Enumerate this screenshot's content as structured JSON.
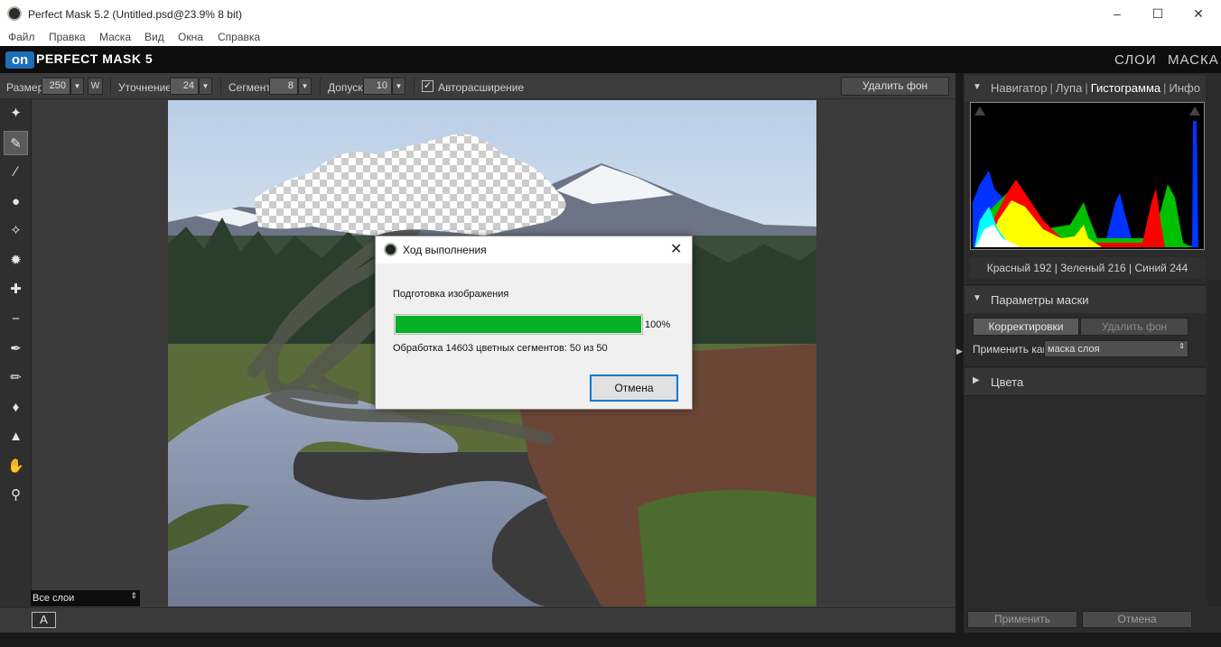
{
  "window": {
    "title": "Perfect Mask 5.2 (Untitled.psd@23.9% 8 bit)",
    "minimize_icon": "minimize-icon",
    "maximize_icon": "maximize-icon",
    "close_icon": "close-icon"
  },
  "menu": {
    "items": [
      "Файл",
      "Правка",
      "Маска",
      "Вид",
      "Окна",
      "Справка"
    ]
  },
  "header": {
    "logo_badge": "on",
    "logo_text": "PERFECT MASK 5",
    "tabs": [
      "СЛОИ",
      "МАСКА"
    ]
  },
  "options": {
    "size_label": "Размер",
    "size_value": "250",
    "w_label": "W",
    "refine_label": "Уточнение",
    "refine_value": "24",
    "segment_label": "Сегмент",
    "segment_value": "8",
    "tolerance_label": "Допуск",
    "tolerance_value": "10",
    "auto_expand_checked": true,
    "auto_expand_label": "Авторасширение",
    "remove_bg_label": "Удалить фон"
  },
  "tools": [
    "magic-brush-keep-icon",
    "magic-brush-drop-icon",
    "magic-brush-icon",
    "magic-brush-plus-icon",
    "magic-sparkle-icon",
    "splatter-icon",
    "eyedropper-plus-icon",
    "eyedropper-minus-icon",
    "pen-icon",
    "brush-icon",
    "drop-icon",
    "bucket-icon",
    "hand-icon",
    "zoom-icon"
  ],
  "layer_filter": {
    "value": "Все слои"
  },
  "bottom": {
    "a_label": "A"
  },
  "right_panel": {
    "nav_tabs": [
      "Навигатор",
      "Лупа",
      "Гистограмма",
      "Инфо"
    ],
    "active_tab": "Гистограмма",
    "histogram_readout": "Красный 192 | Зеленый 216 | Синий 244",
    "mask_params_title": "Параметры маски",
    "corrections_label": "Корректировки",
    "remove_bg_label": "Удалить фон",
    "apply_as_label": "Применить как",
    "apply_as_value": "маска слоя",
    "colors_title": "Цвета",
    "apply_button": "Применить",
    "cancel_button": "Отмена"
  },
  "dialog": {
    "title": "Ход выполнения",
    "status": "Подготовка изображения",
    "progress": 1.0,
    "progress_text": "100%",
    "detail": "Обработка 14603 цветных сегментов: 50 из 50",
    "cancel_label": "Отмена"
  },
  "colors": {
    "progress_green": "#06b025",
    "accent_blue": "#0078d7",
    "logo_blue": "#1b6fb8"
  }
}
